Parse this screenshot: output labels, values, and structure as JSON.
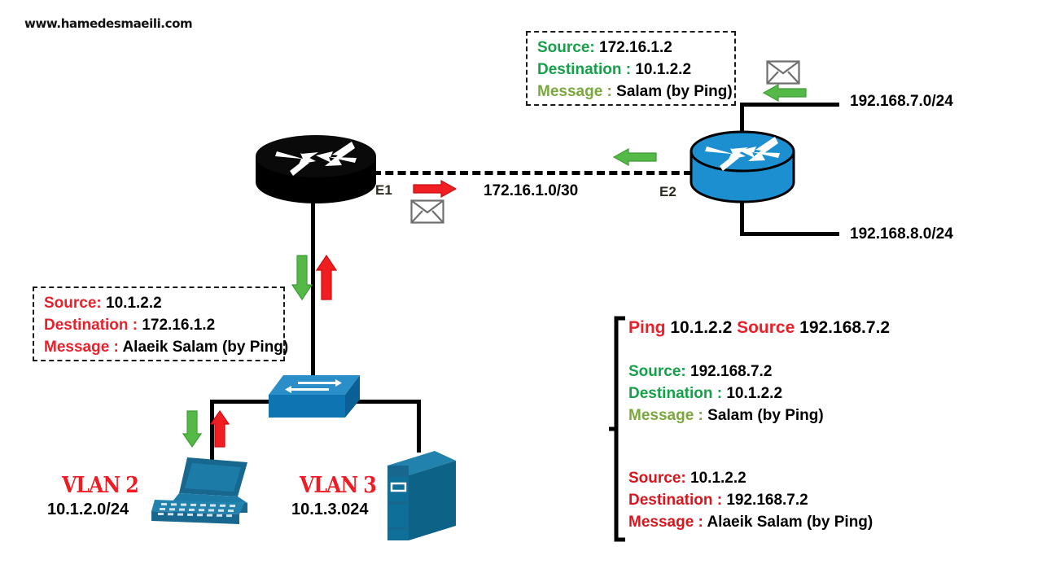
{
  "watermark": "www.hamedesmaeili.com",
  "colors": {
    "green": "#17a04a",
    "olive": "#7aa83c",
    "red": "#e8212b",
    "vlan_red": "#ee1c25",
    "router_blue": "#1b8fd0",
    "device_blue": "#146d96",
    "black": "#000000"
  },
  "top_packet_box": {
    "name": "top-packet-box",
    "rows": [
      {
        "label": "Source:",
        "value": "172.16.1.2",
        "label_color": "green"
      },
      {
        "label": "Destination :",
        "value": "10.1.2.2",
        "label_color": "green"
      },
      {
        "label": "Message :",
        "value": "Salam (by Ping)",
        "label_color": "olive"
      }
    ]
  },
  "left_packet_box": {
    "name": "left-packet-box",
    "rows": [
      {
        "label": "Source:",
        "value": "10.1.2.2",
        "label_color": "red"
      },
      {
        "label": "Destination :",
        "value": "172.16.1.2",
        "label_color": "red"
      },
      {
        "label": "Message :",
        "value": "Alaeik Salam (by Ping)",
        "label_color": "red"
      }
    ]
  },
  "right_panel": {
    "name": "ping-detail-panel",
    "heading": {
      "ping_word": "Ping",
      "ping_target": "10.1.2.2",
      "source_word": "Source",
      "source_value": "192.168.7.2"
    },
    "request": [
      {
        "label": "Source:",
        "value": "192.168.7.2",
        "label_color": "green"
      },
      {
        "label": "Destination :",
        "value": "10.1.2.2",
        "label_color": "green"
      },
      {
        "label": "Message :",
        "value": "Salam (by Ping)",
        "label_color": "olive"
      }
    ],
    "reply": [
      {
        "label": "Source:",
        "value": "10.1.2.2",
        "label_color": "red"
      },
      {
        "label": "Destination :",
        "value": "192.168.7.2",
        "label_color": "red"
      },
      {
        "label": "Message :",
        "value": "Alaeik Salam (by Ping)",
        "label_color": "red"
      }
    ]
  },
  "topology": {
    "black_router": {
      "name": "black-router",
      "interface_label": "E1"
    },
    "blue_router": {
      "name": "blue-router",
      "interface_label": "E2"
    },
    "wan_link_label": "172.16.1.0/30",
    "net_upper_label": "192.168.7.0/24",
    "net_lower_label": "192.168.8.0/24",
    "switch": {
      "name": "access-switch"
    },
    "laptop": {
      "name": "laptop-host"
    },
    "server": {
      "name": "server-host"
    },
    "vlan2": {
      "title": "VLAN 2",
      "subnet": "10.1.2.0/24"
    },
    "vlan3": {
      "title": "VLAN 3",
      "subnet": "10.1.3.024"
    },
    "envelopes": [
      {
        "name": "envelope-icon-wan",
        "dir": "right"
      },
      {
        "name": "envelope-icon-edge",
        "dir": "left"
      }
    ],
    "flow_arrows": [
      {
        "name": "flow-arrow-green-wan",
        "color": "green",
        "dir": "left"
      },
      {
        "name": "flow-arrow-green-edge",
        "color": "green",
        "dir": "left"
      },
      {
        "name": "flow-arrow-red-e1",
        "color": "red",
        "dir": "right"
      },
      {
        "name": "flow-arrow-green-trunk",
        "color": "green",
        "dir": "down"
      },
      {
        "name": "flow-arrow-red-trunk",
        "color": "red",
        "dir": "up"
      },
      {
        "name": "flow-arrow-green-access",
        "color": "green",
        "dir": "down"
      },
      {
        "name": "flow-arrow-red-access",
        "color": "red",
        "dir": "up"
      }
    ]
  }
}
